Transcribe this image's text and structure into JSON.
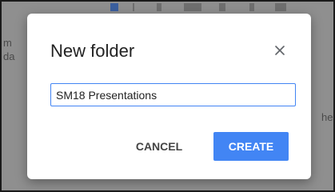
{
  "dialog": {
    "title": "New folder",
    "close_icon": "close-icon",
    "folder_name_value": "SM18 Presentations",
    "cancel_label": "CANCEL",
    "create_label": "CREATE"
  },
  "background": {
    "left_fragment_1": "m",
    "left_fragment_2": "da",
    "right_fragment": "he"
  },
  "colors": {
    "accent": "#4285f4",
    "scrim": "#8f8f8f",
    "dialog_bg": "#ffffff",
    "title_text": "#222222",
    "cancel_text": "#444444"
  }
}
